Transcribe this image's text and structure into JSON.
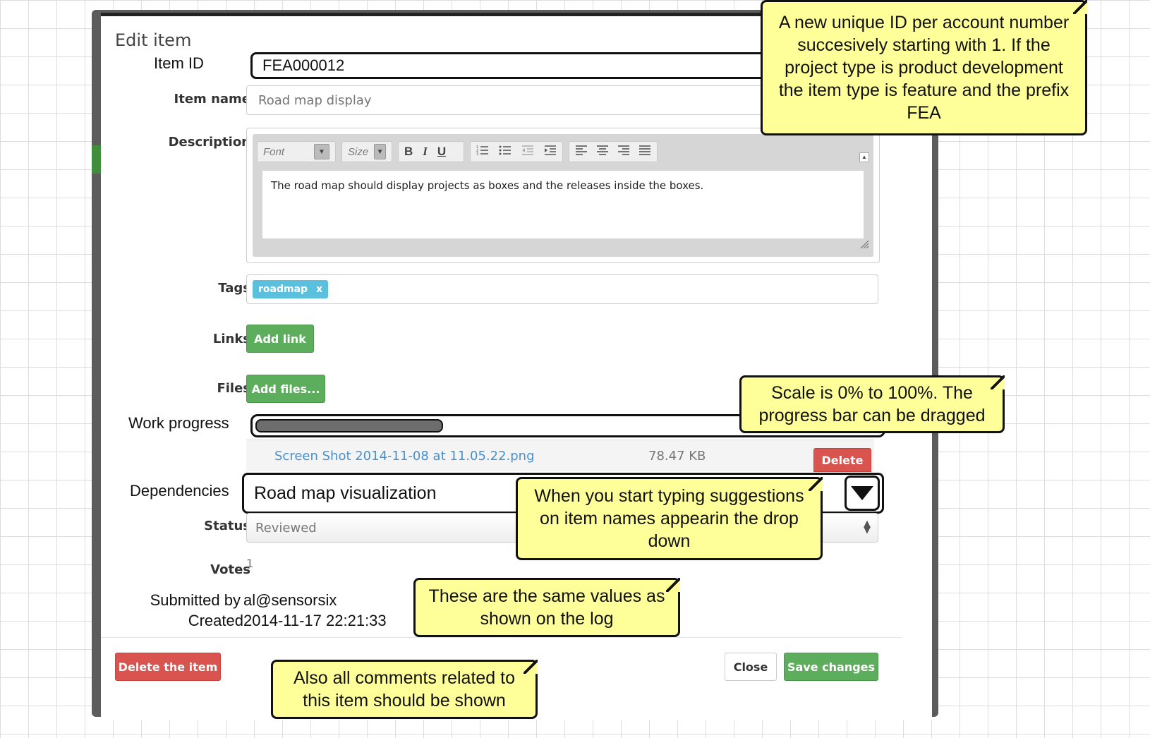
{
  "modal": {
    "title": "Edit item",
    "item_id": {
      "label": "Item ID",
      "value": "FEA000012"
    },
    "item_name": {
      "label": "Item name",
      "placeholder": "Road map display"
    },
    "description": {
      "label": "Description",
      "font_combo": "Font",
      "size_combo": "Size",
      "bold": "B",
      "italic": "I",
      "underline": "U",
      "text": "The road map should display projects as boxes and the releases inside the boxes."
    },
    "tags": {
      "label": "Tags",
      "items": [
        {
          "text": "roadmap",
          "remove": "x"
        }
      ]
    },
    "links": {
      "label": "Links",
      "button": "Add link"
    },
    "files": {
      "label": "Files",
      "button": "Add files...",
      "list": [
        {
          "name": "Screen Shot 2014-11-08 at 11.05.22.png",
          "size": "78.47 KB",
          "delete": "Delete"
        }
      ]
    },
    "work_progress": {
      "label": "Work progress",
      "value_fraction": 0.3
    },
    "dependencies": {
      "label": "Dependencies",
      "value": "Road map visualization"
    },
    "status": {
      "label": "Status",
      "value": "Reviewed"
    },
    "votes": {
      "label": "Votes",
      "value": "1"
    },
    "submitted_by": {
      "label": "Submitted by",
      "value": "al@sensorsix"
    },
    "created": {
      "label": "Created",
      "value": "2014-11-17 22:21:33"
    },
    "footer": {
      "delete": "Delete the item",
      "close": "Close",
      "save": "Save changes"
    }
  },
  "notes": {
    "id_note": "A new unique ID per account number succesively starting with 1. If the project type is product development the item type is feature and the prefix FEA",
    "progress_note": "Scale is 0% to 100%. The progress bar can be dragged",
    "dependencies_note": "When you start typing suggestions on item names appearin the drop down",
    "log_note": "These are the same values as shown on the log",
    "comments_note": "Also all comments related to this item should be shown"
  },
  "colors": {
    "note_fill": "#ffff99",
    "primary_green": "#5cae5c",
    "danger_red": "#d9534f",
    "tag_blue": "#5bc0de",
    "link_blue": "#4a90c8"
  },
  "icons": [
    "chevron-down-icon",
    "ordered-list-icon",
    "unordered-list-icon",
    "outdent-icon",
    "indent-icon",
    "align-left-icon",
    "align-center-icon",
    "align-right-icon",
    "align-justify-icon",
    "resize-handle-icon",
    "collapse-toolbar-icon",
    "select-arrows-icon"
  ]
}
